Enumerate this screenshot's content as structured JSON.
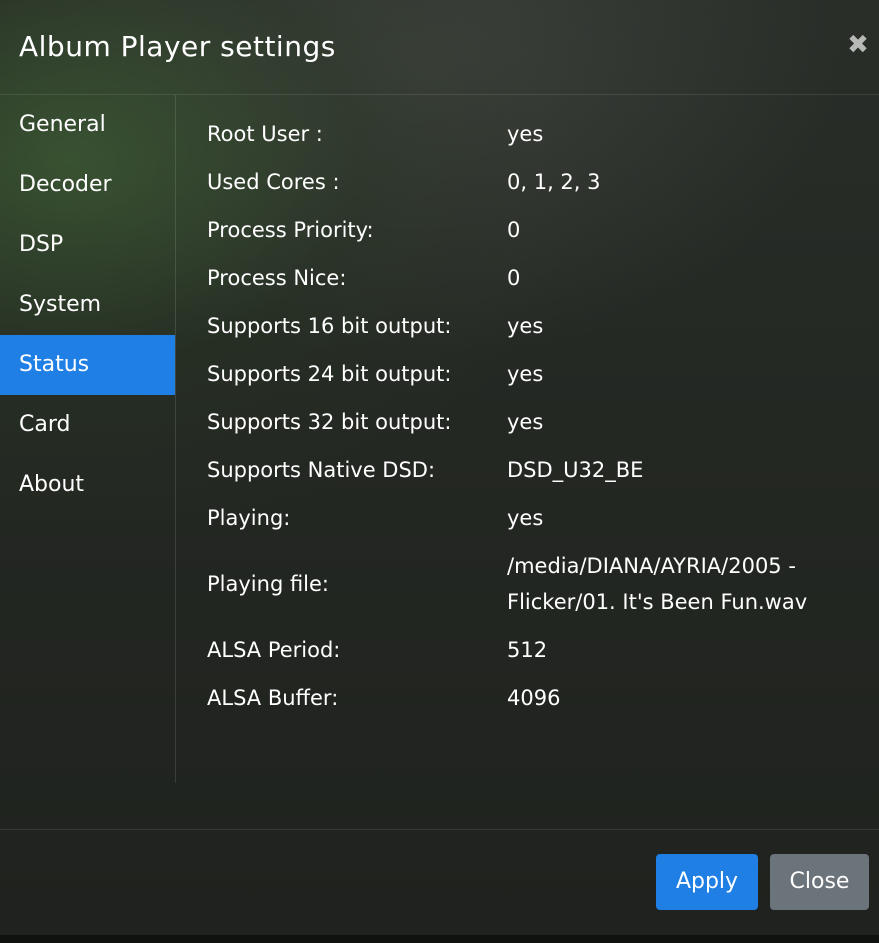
{
  "dialog": {
    "title": "Album Player settings",
    "close_glyph": "✖"
  },
  "sidebar": {
    "items": [
      {
        "label": "General",
        "active": false
      },
      {
        "label": "Decoder",
        "active": false
      },
      {
        "label": "DSP",
        "active": false
      },
      {
        "label": "System",
        "active": false
      },
      {
        "label": "Status",
        "active": true
      },
      {
        "label": "Card",
        "active": false
      },
      {
        "label": "About",
        "active": false
      }
    ]
  },
  "status": {
    "rows": [
      {
        "label": "Root User :",
        "value": "yes"
      },
      {
        "label": "Used Cores :",
        "value": "0, 1, 2, 3"
      },
      {
        "label": "Process Priority:",
        "value": "0"
      },
      {
        "label": "Process Nice:",
        "value": "0"
      },
      {
        "label": "Supports 16 bit output:",
        "value": "yes"
      },
      {
        "label": "Supports 24 bit output:",
        "value": "yes"
      },
      {
        "label": "Supports 32 bit output:",
        "value": "yes"
      },
      {
        "label": "Supports Native DSD:",
        "value": "DSD_U32_BE"
      },
      {
        "label": "Playing:",
        "value": "yes"
      },
      {
        "label": "Playing file:",
        "value": "/media/DIANA/AYRIA/2005 -",
        "value2": "Flicker/01. It's Been Fun.wav"
      },
      {
        "label": "ALSA Period:",
        "value": "512"
      },
      {
        "label": "ALSA Buffer:",
        "value": "4096"
      }
    ]
  },
  "footer": {
    "apply_label": "Apply",
    "close_label": "Close"
  },
  "colors": {
    "accent": "#1f7fe5",
    "secondary_button": "#6b737b"
  },
  "icons": {
    "close": "close-icon"
  }
}
